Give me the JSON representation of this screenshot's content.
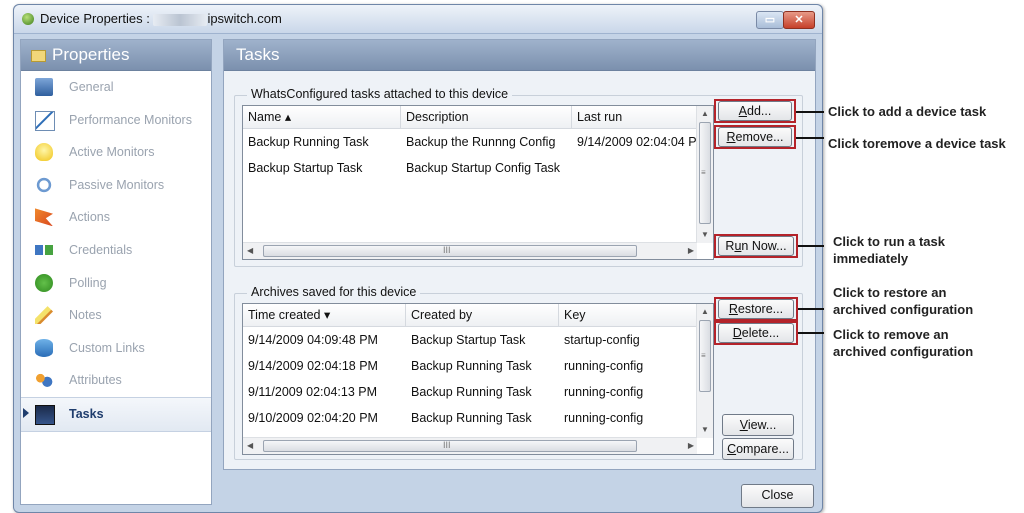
{
  "window": {
    "title_prefix": "Device Properties : ",
    "title_suffix": "ipswitch.com"
  },
  "sidebar": {
    "title": "Properties",
    "items": [
      {
        "label": "General",
        "icon": "monitor-icon"
      },
      {
        "label": "Performance Monitors",
        "icon": "performance-graph-icon"
      },
      {
        "label": "Active Monitors",
        "icon": "lightbulb-icon"
      },
      {
        "label": "Passive Monitors",
        "icon": "passive-monitor-icon"
      },
      {
        "label": "Actions",
        "icon": "actions-flag-icon"
      },
      {
        "label": "Credentials",
        "icon": "credentials-plug-icon"
      },
      {
        "label": "Polling",
        "icon": "polling-check-icon"
      },
      {
        "label": "Notes",
        "icon": "notes-pencil-icon"
      },
      {
        "label": "Custom Links",
        "icon": "custom-links-icon"
      },
      {
        "label": "Attributes",
        "icon": "attributes-people-icon"
      },
      {
        "label": "Tasks",
        "icon": "tasks-screen-icon",
        "selected": true
      }
    ]
  },
  "main": {
    "title": "Tasks",
    "tasks_group": {
      "label": "WhatsConfigured tasks attached to this device",
      "columns": [
        "Name",
        "Description",
        "Last run"
      ],
      "rows": [
        [
          "Backup Running Task",
          "Backup the Runnng Config",
          "9/14/2009 02:04:04 P"
        ],
        [
          "Backup Startup Task",
          "Backup Startup Config Task",
          ""
        ]
      ]
    },
    "archives_group": {
      "label": "Archives saved for this device",
      "columns": [
        "Time created",
        "Created by",
        "Key"
      ],
      "rows": [
        [
          "9/14/2009 04:09:48 PM",
          "Backup Startup Task",
          "startup-config"
        ],
        [
          "9/14/2009 02:04:18 PM",
          "Backup Running Task",
          "running-config"
        ],
        [
          "9/11/2009 02:04:13 PM",
          "Backup Running Task",
          "running-config"
        ],
        [
          "9/10/2009 02:04:20 PM",
          "Backup Running Task",
          "running-config"
        ]
      ]
    },
    "scroll_grip": "III"
  },
  "buttons": {
    "add": {
      "first": "A",
      "rest": "dd..."
    },
    "remove": {
      "first": "R",
      "rest": "emove..."
    },
    "run_now": {
      "pre": "R",
      "first": "u",
      "rest": "n Now..."
    },
    "restore": {
      "first": "R",
      "rest": "estore..."
    },
    "delete": {
      "first": "D",
      "rest": "elete..."
    },
    "view": {
      "first": "V",
      "rest": "iew..."
    },
    "compare": {
      "first": "C",
      "rest": "ompare..."
    },
    "close": "Close"
  },
  "annotations": {
    "add": "Click to add a device task",
    "remove": "Click toremove a device task",
    "run_now_1": "Click to run a task",
    "run_now_2": "immediately",
    "restore_1": "Click to restore an",
    "restore_2": "archived configuration",
    "delete_1": "Click to remove an",
    "delete_2": "archived configuration"
  },
  "colors": {
    "highlight_border": "#b4232a",
    "header_gradient": "#7b90ae",
    "window_frame": "#c4d3e6"
  }
}
